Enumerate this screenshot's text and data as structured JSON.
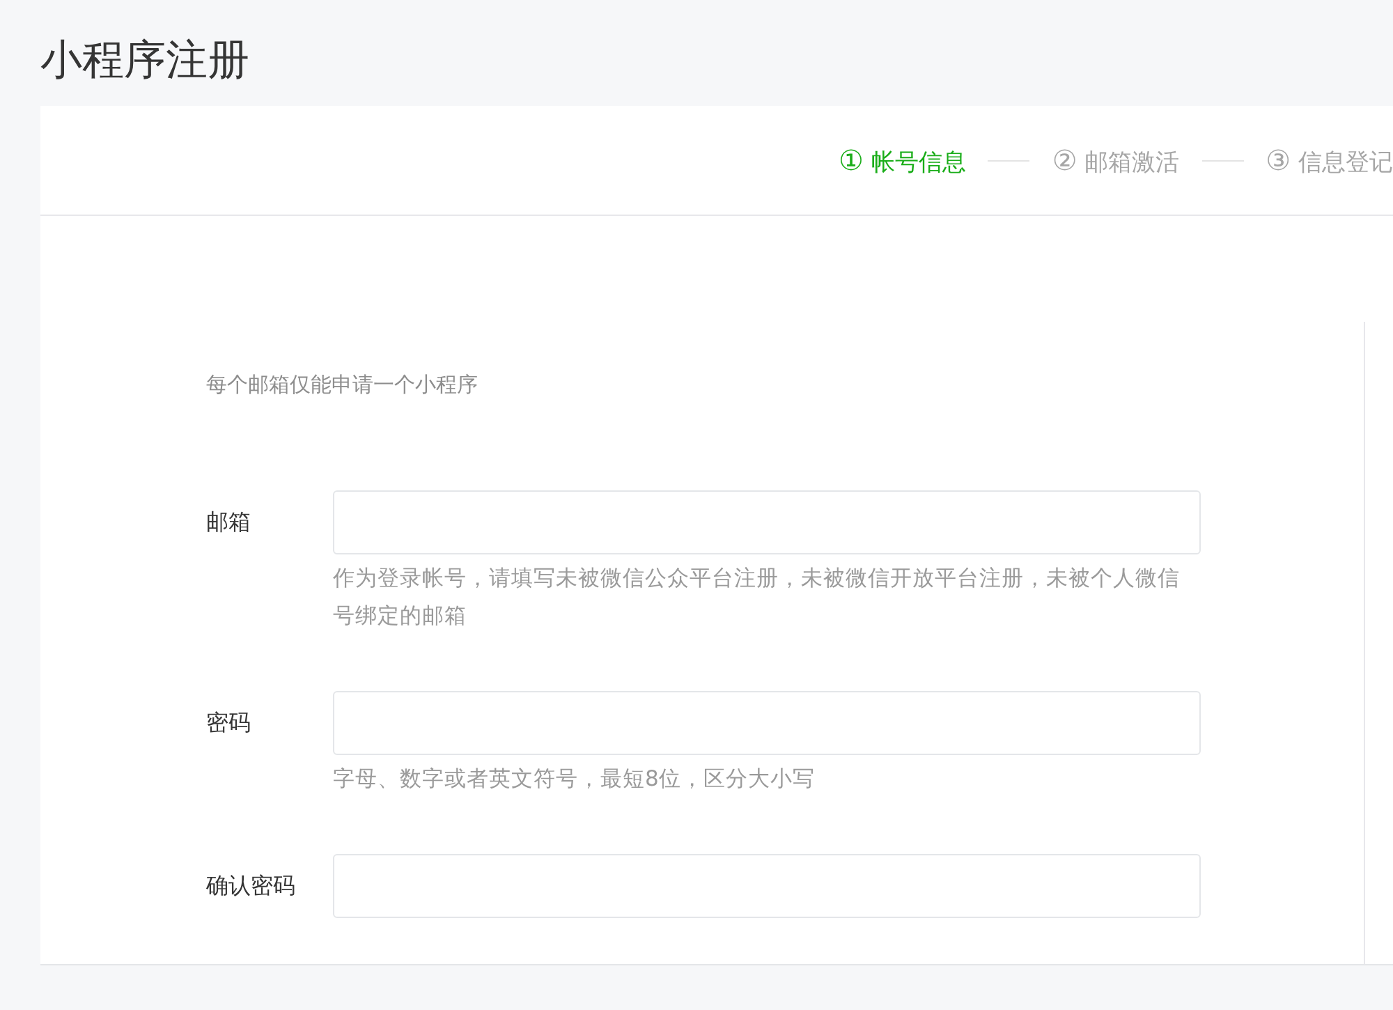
{
  "page_title": "小程序注册",
  "steps": [
    {
      "number": "①",
      "label": "帐号信息",
      "selected": true
    },
    {
      "number": "②",
      "label": "邮箱激活",
      "selected": false
    },
    {
      "number": "③",
      "label": "信息登记",
      "selected": false
    }
  ],
  "notice": "每个邮箱仅能申请一个小程序",
  "fields": [
    {
      "label": "邮箱",
      "hint": "作为登录帐号，请填写未被微信公众平台注册，未被微信开放平台注册，未被个人微信号绑定的邮箱"
    },
    {
      "label": "密码",
      "hint": "字母、数字或者英文符号，最短8位，区分大小写"
    },
    {
      "label": "确认密码"
    }
  ]
}
